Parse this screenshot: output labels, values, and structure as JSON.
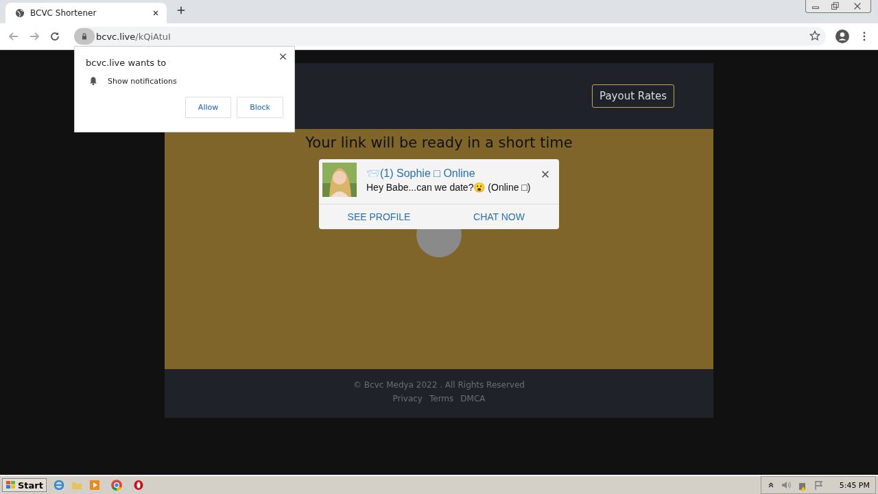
{
  "browser": {
    "tab_title": "BCVC Shortener",
    "url_host": "bcvc.live",
    "url_path": "/kQiAtuI"
  },
  "permission_prompt": {
    "title": "bcvc.live wants to",
    "permission": "Show notifications",
    "buttons": [
      "Allow",
      "Block"
    ]
  },
  "page": {
    "header_button": "Payout Rates",
    "heading": "Your link will be ready in a short time",
    "footer": {
      "copyright": "© Bcvc Medya 2022 . All Rights Reserved",
      "links": [
        "Privacy",
        "Terms",
        "DMCA"
      ]
    }
  },
  "chat_popup": {
    "avatar": {
      "kind": "picture"
    },
    "title": "📨(1) Sophie □ Online",
    "message": "Hey Babe...can we date?😮 (Online □)",
    "actions": [
      "SEE PROFILE",
      "CHAT NOW"
    ]
  },
  "taskbar": {
    "start": "Start",
    "clock": "5:45 PM"
  }
}
